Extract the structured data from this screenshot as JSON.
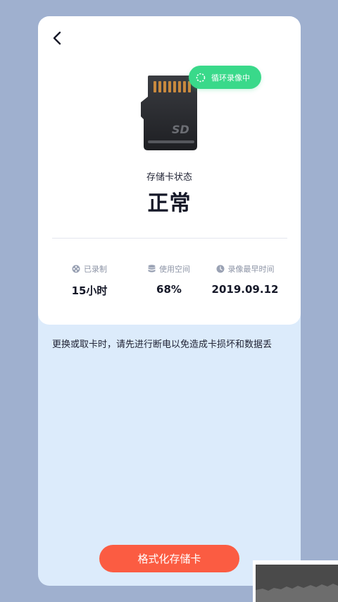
{
  "colors": {
    "background": "#9fb0cf",
    "panel": "#dcebfb",
    "card": "#ffffff",
    "accent_green": "#39d98a",
    "accent_red": "#fb5c42",
    "text_dark": "#151828",
    "text_muted": "#8d94a6"
  },
  "header": {
    "back_icon": "chevron-left-icon"
  },
  "sd_card": {
    "icon": "sd-card-icon",
    "label": "SD"
  },
  "badge": {
    "icon": "loop-icon",
    "text": "循环录像中"
  },
  "status": {
    "label": "存储卡状态",
    "value": "正常"
  },
  "stats": [
    {
      "icon": "film-reel-icon",
      "label": "已录制",
      "value": "15小时"
    },
    {
      "icon": "database-icon",
      "label": "使用空间",
      "value": "68%"
    },
    {
      "icon": "clock-icon",
      "label": "录像最早时间",
      "value": "2019.09.12"
    }
  ],
  "notice": "更换或取卡时，请先进行断电以免造成卡损坏和数据丢",
  "format_button": "格式化存储卡"
}
